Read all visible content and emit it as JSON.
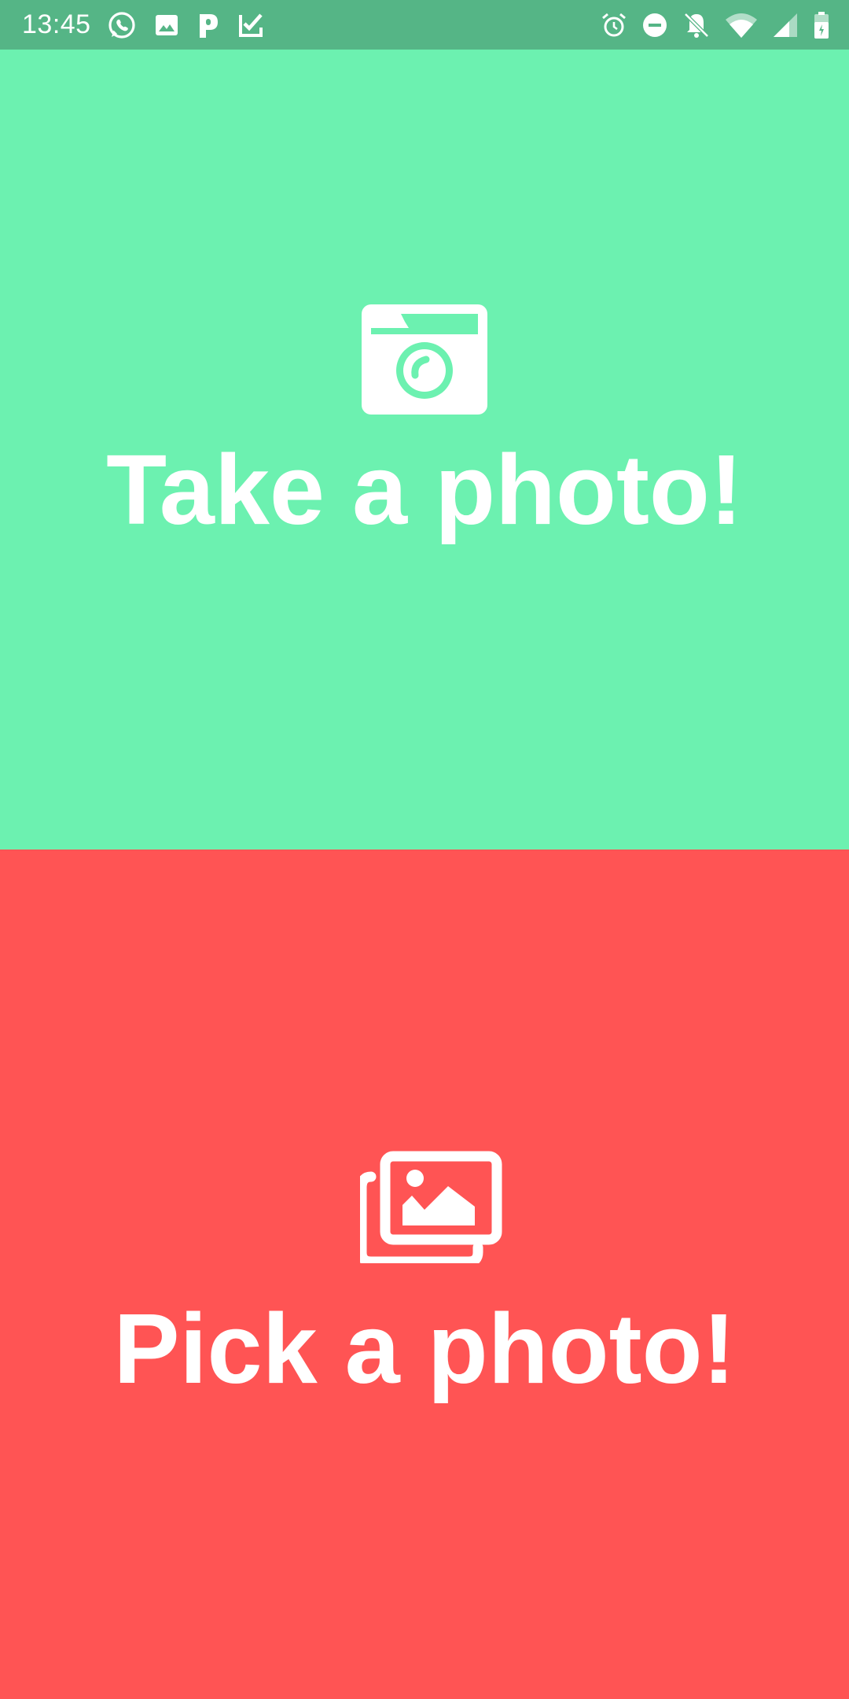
{
  "status_bar": {
    "time": "13:45",
    "left_icons": [
      "whatsapp-icon",
      "image-notification-icon",
      "parking-app-icon",
      "checklist-app-icon"
    ],
    "right_icons": [
      "alarm-icon",
      "do-not-disturb-icon",
      "notifications-off-icon",
      "wifi-icon",
      "cellular-signal-icon",
      "battery-icon"
    ],
    "background_color": "#55b586"
  },
  "take_photo": {
    "label": "Take a photo!",
    "icon": "camera-icon",
    "background_color": "#6cf1b0"
  },
  "pick_photo": {
    "label": "Pick a photo!",
    "icon": "photo-library-icon",
    "background_color": "#ff5454"
  }
}
